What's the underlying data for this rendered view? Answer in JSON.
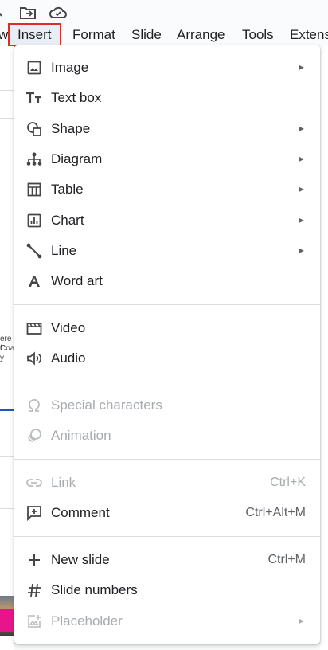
{
  "menubar": {
    "items": [
      {
        "label": "w"
      },
      {
        "label": "Insert"
      },
      {
        "label": "Format"
      },
      {
        "label": "Slide"
      },
      {
        "label": "Arrange"
      },
      {
        "label": "Tools"
      },
      {
        "label": "Extens"
      }
    ]
  },
  "toolbar_icons": [
    "star-icon",
    "move-to-folder-icon",
    "cloud-saved-icon"
  ],
  "insert_menu": {
    "groups": [
      [
        {
          "label": "Image",
          "icon": "image-icon",
          "submenu": true
        },
        {
          "label": "Text box",
          "icon": "text-box-icon"
        },
        {
          "label": "Shape",
          "icon": "shape-icon",
          "submenu": true
        },
        {
          "label": "Diagram",
          "icon": "diagram-icon",
          "submenu": true
        },
        {
          "label": "Table",
          "icon": "table-icon",
          "submenu": true
        },
        {
          "label": "Chart",
          "icon": "chart-icon",
          "submenu": true
        },
        {
          "label": "Line",
          "icon": "line-icon",
          "submenu": true
        },
        {
          "label": "Word art",
          "icon": "word-art-icon"
        }
      ],
      [
        {
          "label": "Video",
          "icon": "video-icon"
        },
        {
          "label": "Audio",
          "icon": "audio-icon"
        }
      ],
      [
        {
          "label": "Special characters",
          "icon": "omega-icon",
          "disabled": true
        },
        {
          "label": "Animation",
          "icon": "animation-icon",
          "disabled": true
        }
      ],
      [
        {
          "label": "Link",
          "icon": "link-icon",
          "shortcut": "Ctrl+K",
          "disabled": true
        },
        {
          "label": "Comment",
          "icon": "comment-icon",
          "shortcut": "Ctrl+Alt+M"
        }
      ],
      [
        {
          "label": "New slide",
          "icon": "plus-icon",
          "shortcut": "Ctrl+M"
        },
        {
          "label": "Slide numbers",
          "icon": "hash-icon"
        },
        {
          "label": "Placeholder",
          "icon": "placeholder-icon",
          "submenu": true,
          "disabled": true
        }
      ]
    ],
    "submenu_arrow": "►"
  },
  "slide_thumbnail_text": {
    "line1": "ere f",
    "line2": "Coas",
    "line3": "y"
  },
  "colors": {
    "active_outline": "#d93025",
    "accent_blue": "#1a56c6",
    "accent_pink": "#e8148c"
  }
}
